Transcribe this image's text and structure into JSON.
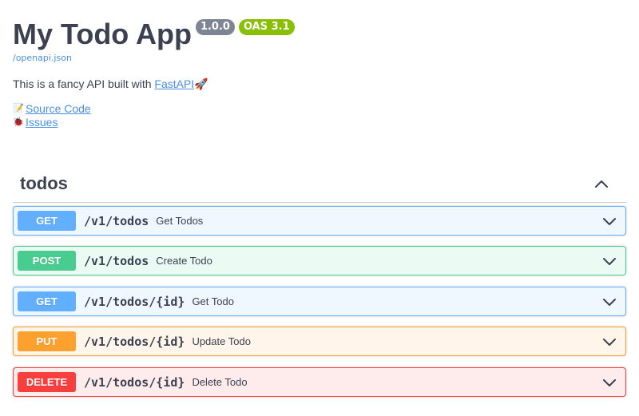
{
  "info": {
    "title": "My Todo App",
    "version_badge": "1.0.0",
    "oas_badge": "OAS 3.1",
    "spec_link": "/openapi.json",
    "description_prefix": "This is a fancy API built with ",
    "description_link": "FastAPI",
    "description_suffix": "🚀",
    "links": [
      {
        "emoji": "📝",
        "label": "Source Code"
      },
      {
        "emoji": "🐞",
        "label": "Issues"
      }
    ]
  },
  "tag": {
    "name": "todos",
    "expanded": true,
    "icon": "chevron-up-icon"
  },
  "operations": [
    {
      "method": "GET",
      "path": "/v1/todos",
      "summary": "Get Todos"
    },
    {
      "method": "POST",
      "path": "/v1/todos",
      "summary": "Create Todo"
    },
    {
      "method": "GET",
      "path": "/v1/todos/{id}",
      "summary": "Get Todo"
    },
    {
      "method": "PUT",
      "path": "/v1/todos/{id}",
      "summary": "Update Todo"
    },
    {
      "method": "DELETE",
      "path": "/v1/todos/{id}",
      "summary": "Delete Todo"
    }
  ],
  "colors": {
    "get": "#61affe",
    "post": "#49cc90",
    "put": "#fca130",
    "delete": "#f93e3e",
    "version_badge": "#7d8492",
    "oas_badge": "#89bf04",
    "link": "#4990e2",
    "text": "#3b4151"
  }
}
